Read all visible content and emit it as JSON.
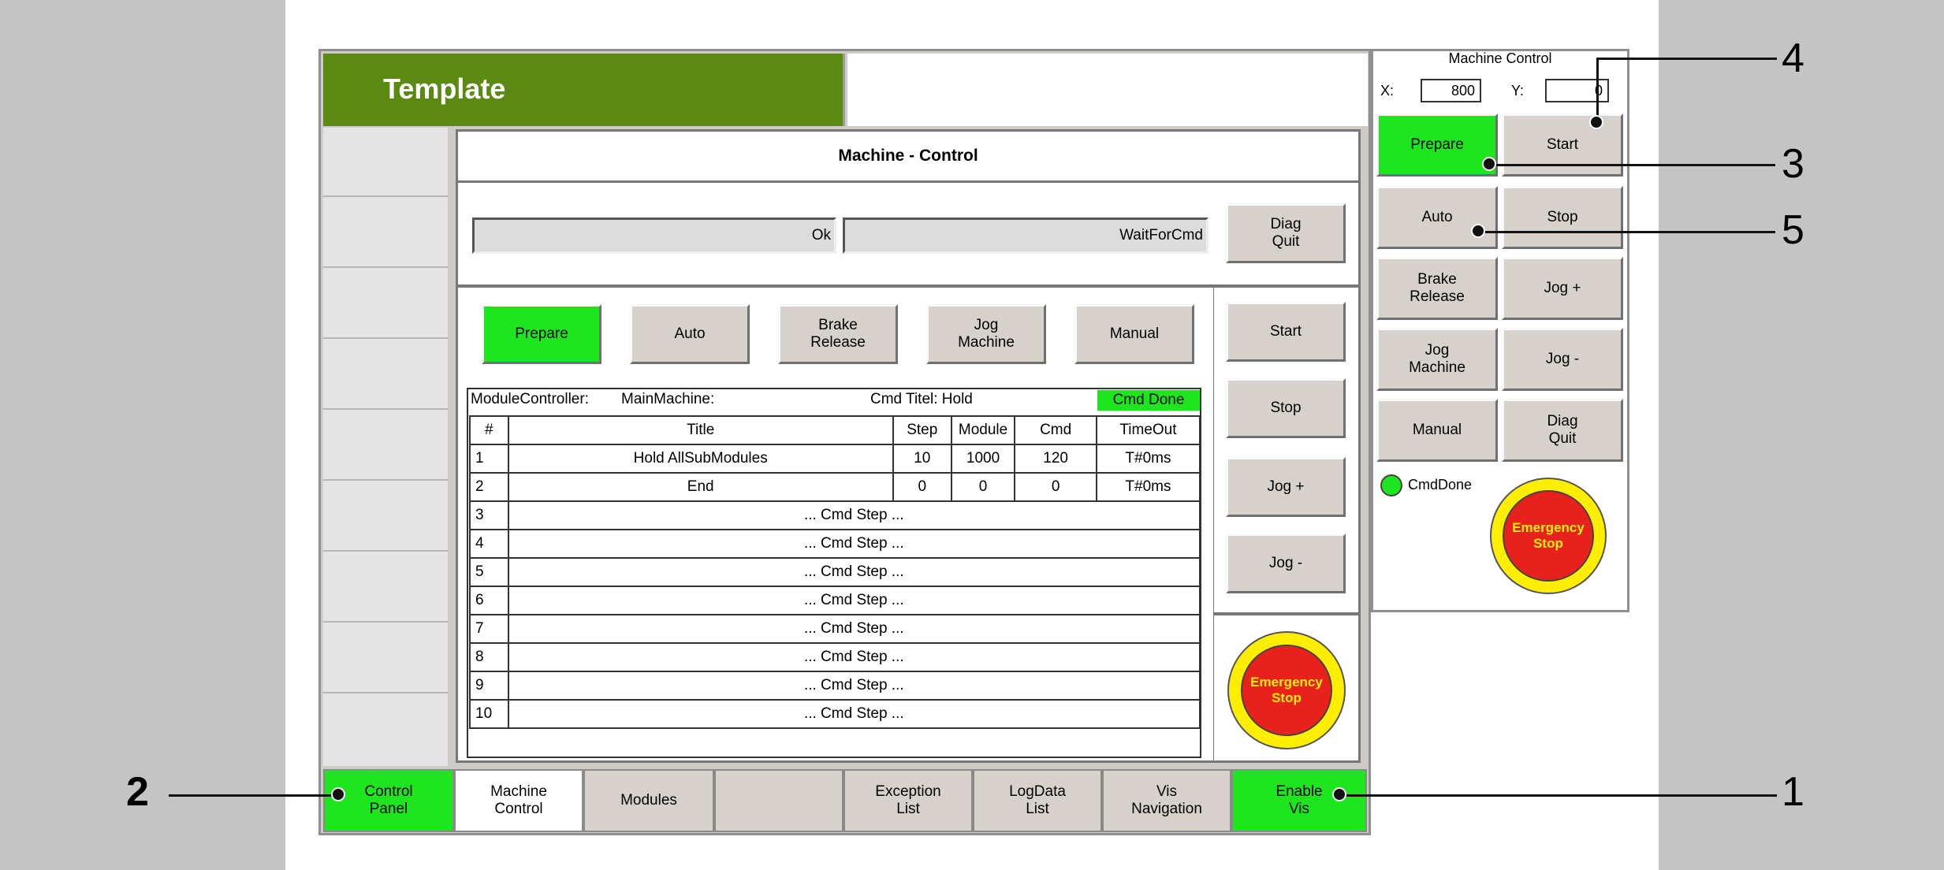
{
  "header": {
    "title": "Template"
  },
  "machine_control": {
    "title": "Machine - Control",
    "status_left": "Ok",
    "status_right": "WaitForCmd",
    "diag_quit": "Diag\nQuit",
    "mode_buttons": [
      "Prepare",
      "Auto",
      "Brake\nRelease",
      "Jog\nMachine",
      "Manual"
    ],
    "side_buttons": [
      "Start",
      "Stop",
      "Jog +",
      "Jog -"
    ],
    "emergency": "Emergency\nStop"
  },
  "module_table": {
    "controller_label": "ModuleController:",
    "controller_value": "MainMachine:",
    "cmd_title": "Cmd Titel: Hold",
    "cmd_status": "Cmd Done",
    "columns": [
      "#",
      "Title",
      "Step",
      "Module",
      "Cmd",
      "TimeOut"
    ],
    "rows": [
      [
        "1",
        "Hold AllSubModules",
        "10",
        "1000",
        "120",
        "T#0ms"
      ],
      [
        "2",
        "End",
        "0",
        "0",
        "0",
        "T#0ms"
      ]
    ],
    "placeholder_rows": [
      "3",
      "4",
      "5",
      "6",
      "7",
      "8",
      "9",
      "10"
    ],
    "placeholder_text": "... Cmd Step ..."
  },
  "tabs": [
    "Control\nPanel",
    "Machine\nControl",
    "Modules",
    "",
    "Exception\nList",
    "LogData\nList",
    "Vis\nNavigation",
    "Enable\nVis"
  ],
  "side_panel": {
    "title": "Machine Control",
    "x_label": "X:",
    "x_value": "800",
    "y_label": "Y:",
    "y_value": "0",
    "buttons": [
      "Prepare",
      "Start",
      "Auto",
      "Stop",
      "Brake\nRelease",
      "Jog +",
      "Jog\nMachine",
      "Jog -",
      "Manual",
      "Diag\nQuit"
    ],
    "cmd_done": "CmdDone",
    "emergency": "Emergency\nStop"
  },
  "callouts": [
    "1",
    "2",
    "3",
    "4",
    "5"
  ],
  "colors": {
    "active_green": "#1ee61e",
    "title_green": "#5a8a12",
    "estop_red": "#e8211c",
    "estop_yellow": "#ffee00"
  }
}
